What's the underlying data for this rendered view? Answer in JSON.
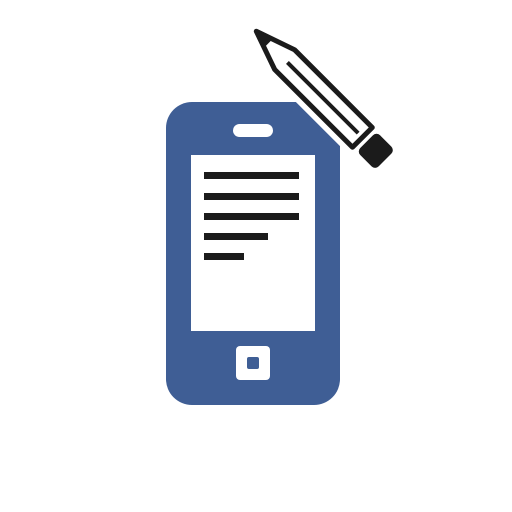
{
  "icon": {
    "name": "mobile-note-edit-icon",
    "colors": {
      "phone_body": "#3F5E95",
      "screen": "#FFFFFF",
      "lines": "#1B1B1B",
      "pencil": "#1B1B1B",
      "background": "#FFFFFF"
    }
  }
}
